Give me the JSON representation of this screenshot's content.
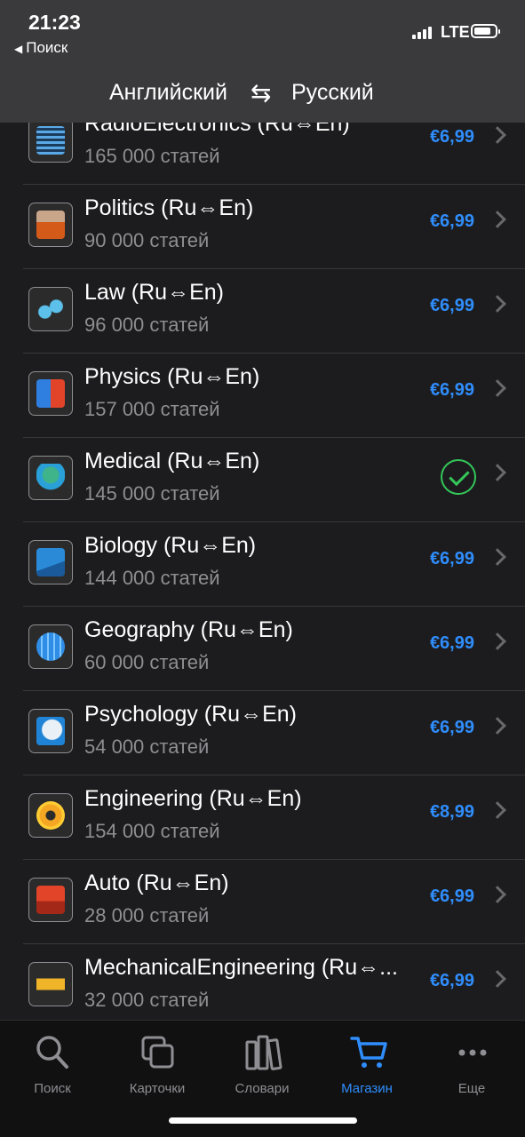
{
  "status": {
    "time": "21:23",
    "back": "Поиск",
    "network": "LTE"
  },
  "header": {
    "from_lang": "Английский",
    "to_lang": "Русский"
  },
  "items": [
    {
      "title": "RadioElectronics (Ru⇔En)",
      "count": "165 000 статей",
      "price": "€6,99",
      "icon": "radio-electronics-icon",
      "owned": false
    },
    {
      "title": "Politics (Ru⇔En)",
      "count": "90 000 статей",
      "price": "€6,99",
      "icon": "politics-icon",
      "owned": false
    },
    {
      "title": "Law (Ru⇔En)",
      "count": "96 000 статей",
      "price": "€6,99",
      "icon": "law-scales-icon",
      "owned": false
    },
    {
      "title": "Physics (Ru⇔En)",
      "count": "157 000 статей",
      "price": "€6,99",
      "icon": "physics-magnet-icon",
      "owned": false
    },
    {
      "title": "Medical (Ru⇔En)",
      "count": "145 000 статей",
      "price": "",
      "icon": "medical-icon",
      "owned": true
    },
    {
      "title": "Biology (Ru⇔En)",
      "count": "144 000 статей",
      "price": "€6,99",
      "icon": "biology-microscope-icon",
      "owned": false
    },
    {
      "title": "Geography (Ru⇔En)",
      "count": "60 000 статей",
      "price": "€6,99",
      "icon": "geography-globe-icon",
      "owned": false
    },
    {
      "title": "Psychology (Ru⇔En)",
      "count": "54 000 статей",
      "price": "€6,99",
      "icon": "psychology-head-icon",
      "owned": false
    },
    {
      "title": "Engineering (Ru⇔En)",
      "count": "154 000 статей",
      "price": "€8,99",
      "icon": "engineering-gear-icon",
      "owned": false
    },
    {
      "title": "Auto (Ru⇔En)",
      "count": "28 000 статей",
      "price": "€6,99",
      "icon": "auto-car-icon",
      "owned": false
    },
    {
      "title": "MechanicalEngineering (Ru⇔...",
      "count": "32 000 статей",
      "price": "€6,99",
      "icon": "mechanical-tractor-icon",
      "owned": false
    }
  ],
  "tabs": [
    {
      "label": "Поиск",
      "icon": "search-icon"
    },
    {
      "label": "Карточки",
      "icon": "cards-icon"
    },
    {
      "label": "Словари",
      "icon": "dictionaries-icon"
    },
    {
      "label": "Магазин",
      "icon": "cart-icon",
      "active": true
    },
    {
      "label": "Еще",
      "icon": "more-icon"
    }
  ],
  "colors": {
    "accent": "#2f8dfc",
    "owned": "#34c759",
    "background": "#1c1c1e",
    "header": "#3a3a3c"
  }
}
